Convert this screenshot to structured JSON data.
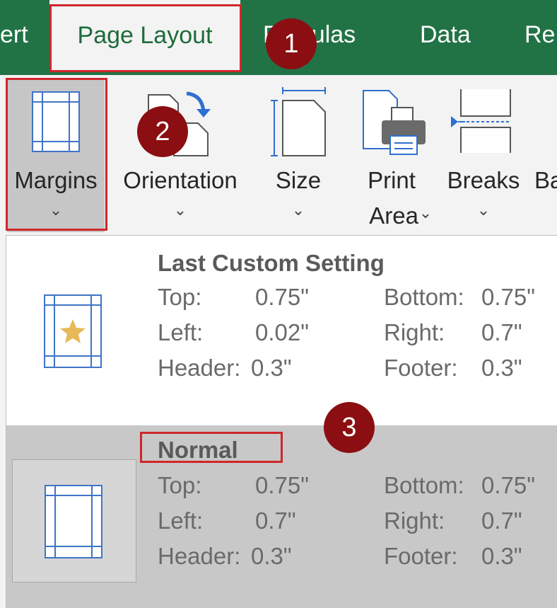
{
  "tabs": {
    "insert_partial": "ert",
    "page_layout": "Page Layout",
    "formulas_partial_left": "F",
    "formulas_partial_right": "ulas",
    "data": "Data",
    "review_partial": "Re"
  },
  "ribbon": {
    "margins": {
      "label": "Margins",
      "chevron": "⌄",
      "icon": "margins-icon"
    },
    "orientation": {
      "label": "Orientation",
      "chevron": "⌄",
      "icon": "orientation-icon"
    },
    "size": {
      "label": "Size",
      "chevron": "⌄",
      "icon": "size-icon"
    },
    "print_area": {
      "label_line1": "Print",
      "label_line2": "Area",
      "chevron": "⌄",
      "icon": "print-area-icon"
    },
    "breaks": {
      "label": "Breaks",
      "chevron": "⌄",
      "icon": "breaks-icon"
    },
    "background_partial": "Ba"
  },
  "margin_options": [
    {
      "title": "Last Custom Setting",
      "icon": "custom-margins-star-icon",
      "top_label": "Top:",
      "top": "0.75\"",
      "bottom_label": "Bottom:",
      "bottom": "0.75\"",
      "left_label": "Left:",
      "left": "0.02\"",
      "right_label": "Right:",
      "right": "0.7\"",
      "header_label": "Header:",
      "header": "0.3\"",
      "footer_label": "Footer:",
      "footer": "0.3\""
    },
    {
      "title": "Normal",
      "icon": "normal-margins-icon",
      "top_label": "Top:",
      "top": "0.75\"",
      "bottom_label": "Bottom:",
      "bottom": "0.75\"",
      "left_label": "Left:",
      "left": "0.7\"",
      "right_label": "Right:",
      "right": "0.7\"",
      "header_label": "Header:",
      "header": "0.3\"",
      "footer_label": "Footer:",
      "footer": "0.3\""
    }
  ],
  "badges": [
    "1",
    "2",
    "3"
  ],
  "colors": {
    "ribbon_green": "#217346",
    "highlight_red": "#d0262b",
    "badge_red": "#8b0e12",
    "selected_gray": "#c8c8c8",
    "icon_blue": "#3f74c6",
    "star_gold": "#e7b95a"
  }
}
